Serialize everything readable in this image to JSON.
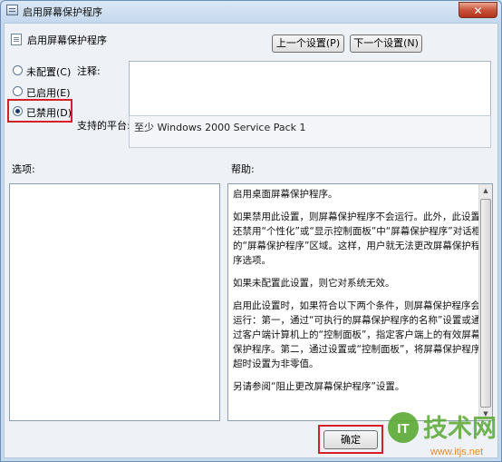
{
  "window": {
    "title": "启用屏幕保护程序",
    "close_symbol": "✕"
  },
  "header": {
    "setting_name": "启用屏幕保护程序",
    "prev_button": "上一个设置(P)",
    "next_button": "下一个设置(N)"
  },
  "state_options": [
    {
      "label": "未配置(C)",
      "checked": false
    },
    {
      "label": "已启用(E)",
      "checked": false
    },
    {
      "label": "已禁用(D)",
      "checked": true
    }
  ],
  "comment": {
    "label": "注释:",
    "value": ""
  },
  "platform": {
    "label": "支持的平台:",
    "value": "至少 Windows 2000 Service Pack 1"
  },
  "options_pane": {
    "label": "选项:"
  },
  "help_pane": {
    "label": "帮助:",
    "paragraphs": [
      "启用桌面屏幕保护程序。",
      "如果禁用此设置，则屏幕保护程序不会运行。此外，此设置还禁用“个性化”或“显示控制面板”中“屏幕保护程序”对话框的“屏幕保护程序”区域。这样，用户就无法更改屏幕保护程序选项。",
      "如果未配置此设置，则它对系统无效。",
      "启用此设置时，如果符合以下两个条件，则屏幕保护程序会运行：第一，通过“可执行的屏幕保护程序的名称”设置或通过客户端计算机上的“控制面板”，指定客户端上的有效屏幕保护程序。第二，通过设置或“控制面板”，将屏幕保护程序超时设置为非零值。",
      "另请参阅“阻止更改屏幕保护程序”设置。"
    ]
  },
  "footer": {
    "ok_button": "确定"
  },
  "watermark": {
    "brand": "技术网",
    "url": "www.itjs.net",
    "logo_letters": "IT"
  },
  "colors": {
    "highlight": "#d4202a",
    "watermark_green": "#5aa832"
  },
  "icons": {
    "close": "close-icon",
    "title": "policy-window-icon",
    "setting": "policy-setting-icon"
  }
}
